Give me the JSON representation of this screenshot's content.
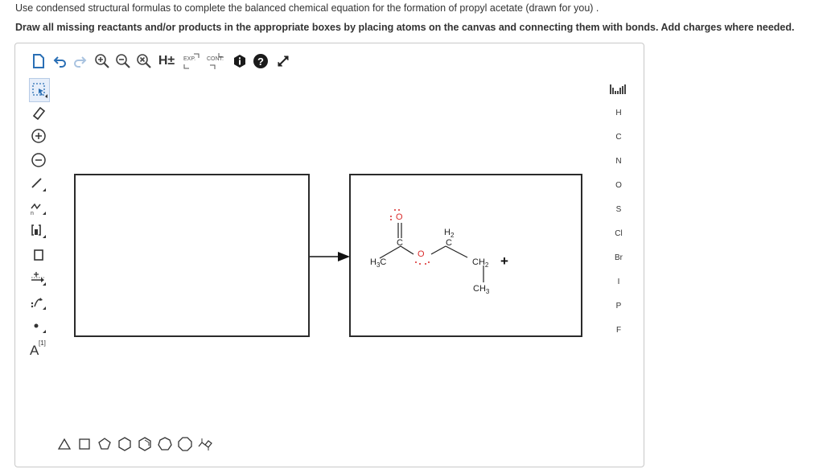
{
  "question": {
    "instruction": "Use condensed structural formulas to complete the balanced chemical equation for the formation of propyl acetate (drawn for you) .",
    "directions": "Draw all missing reactants and/or products in the appropriate boxes by placing atoms on the canvas and connecting them with bonds. Add charges where needed."
  },
  "toolbar": {
    "explicit_h_label": "H±",
    "expand_label": "EXP.",
    "contract_label": "CONT."
  },
  "left_toolbar": {
    "text_tool_label": "A",
    "text_tool_superscript": "[1]"
  },
  "elements": [
    "H",
    "C",
    "N",
    "O",
    "S",
    "Cl",
    "Br",
    "I",
    "P",
    "F"
  ],
  "molecule": {
    "ch3_left_main": "H",
    "ch3_left_sub": "3",
    "ch3_left_tail": "C",
    "carbonyl_c": "C",
    "ch2_top_main": "H",
    "ch2_top_sub": "2",
    "ch2_top_c": "C",
    "ester_o": "O",
    "carbonyl_o": "O",
    "ch2_right_main": "CH",
    "ch2_right_sub": "2",
    "ch3_bottom_main": "CH",
    "ch3_bottom_sub": "3"
  },
  "equation": {
    "plus_sign": "+"
  },
  "colors": {
    "oxygen": "#d92b2b",
    "accent": "#2a6fb5",
    "box_border": "#2b2b2b"
  }
}
